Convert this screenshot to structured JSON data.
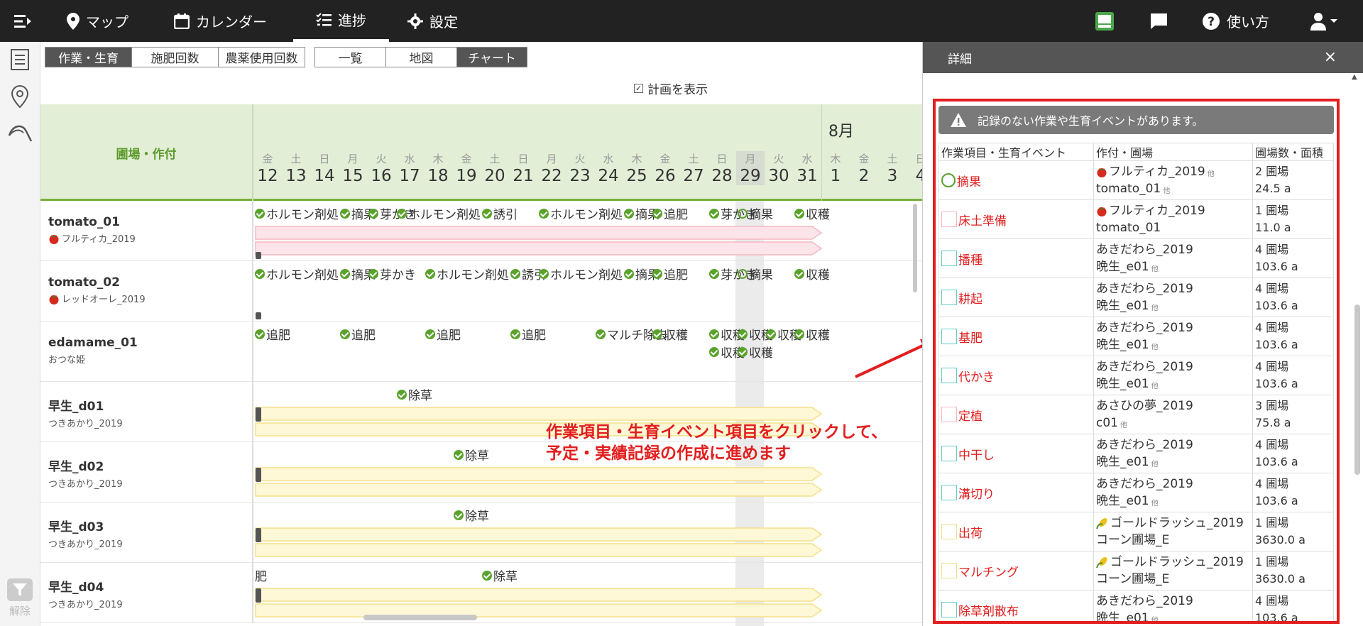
{
  "nav": {
    "map": "マップ",
    "calendar": "カレンダー",
    "progress": "進捗",
    "settings": "設定",
    "help": "使い方"
  },
  "filter": {
    "release": "解除"
  },
  "tabs_left": [
    "作業・生育",
    "施肥回数",
    "農薬使用回数"
  ],
  "tabs_right": [
    "一覧",
    "地図",
    "チャート"
  ],
  "plan_toggle": "計画を表示",
  "gantt": {
    "header_title": "圃場・作付",
    "month": "8月",
    "days": [
      {
        "dow": "金",
        "num": "12"
      },
      {
        "dow": "土",
        "num": "13"
      },
      {
        "dow": "日",
        "num": "14"
      },
      {
        "dow": "月",
        "num": "15"
      },
      {
        "dow": "火",
        "num": "16"
      },
      {
        "dow": "水",
        "num": "17"
      },
      {
        "dow": "木",
        "num": "18"
      },
      {
        "dow": "金",
        "num": "19"
      },
      {
        "dow": "土",
        "num": "20"
      },
      {
        "dow": "日",
        "num": "21"
      },
      {
        "dow": "月",
        "num": "22"
      },
      {
        "dow": "火",
        "num": "23"
      },
      {
        "dow": "水",
        "num": "24"
      },
      {
        "dow": "木",
        "num": "25"
      },
      {
        "dow": "金",
        "num": "26"
      },
      {
        "dow": "土",
        "num": "27"
      },
      {
        "dow": "日",
        "num": "28"
      },
      {
        "dow": "月",
        "num": "29"
      },
      {
        "dow": "火",
        "num": "30"
      },
      {
        "dow": "水",
        "num": "31"
      },
      {
        "dow": "木",
        "num": "1"
      },
      {
        "dow": "金",
        "num": "2"
      },
      {
        "dow": "土",
        "num": "3"
      },
      {
        "dow": "日",
        "num": "4"
      }
    ],
    "rows": [
      {
        "name": "tomato_01",
        "sub": "フルティカ_2019",
        "bar": "pink"
      },
      {
        "name": "tomato_02",
        "sub": "レッドオーレ_2019",
        "bar": "none"
      },
      {
        "name": "edamame_01",
        "sub": "おつな姫",
        "bar": "none"
      },
      {
        "name": "早生_d01",
        "sub": "つきあかり_2019",
        "bar": "yellow"
      },
      {
        "name": "早生_d02",
        "sub": "つきあかり_2019",
        "bar": "yellow"
      },
      {
        "name": "早生_d03",
        "sub": "つきあかり_2019",
        "bar": "yellow"
      },
      {
        "name": "早生_d04",
        "sub": "つきあかり_2019",
        "bar": "yellow"
      }
    ],
    "chips": [
      {
        "row": 0,
        "day": 0,
        "text": "ホルモン剤処",
        "line": 0
      },
      {
        "row": 0,
        "day": 3,
        "text": "摘果",
        "line": 0
      },
      {
        "row": 0,
        "day": 4,
        "text": "芽かき",
        "line": 0
      },
      {
        "row": 0,
        "day": 5,
        "text": "ホルモン剤処",
        "line": 0
      },
      {
        "row": 0,
        "day": 8,
        "text": "誘引",
        "line": 0
      },
      {
        "row": 0,
        "day": 10,
        "text": "ホルモン剤処",
        "line": 0
      },
      {
        "row": 0,
        "day": 13,
        "text": "摘果",
        "line": 0
      },
      {
        "row": 0,
        "day": 14,
        "text": "追肥",
        "line": 0
      },
      {
        "row": 0,
        "day": 16,
        "text": "芽かき",
        "line": 0
      },
      {
        "row": 0,
        "day": 17,
        "text": "摘果",
        "line": 0,
        "ring": true
      },
      {
        "row": 0,
        "day": 19,
        "text": "収穫",
        "line": 0
      },
      {
        "row": 1,
        "day": 0,
        "text": "ホルモン剤処",
        "line": 0
      },
      {
        "row": 1,
        "day": 3,
        "text": "摘果",
        "line": 0
      },
      {
        "row": 1,
        "day": 4,
        "text": "芽かき",
        "line": 0
      },
      {
        "row": 1,
        "day": 6,
        "text": "ホルモン剤処",
        "line": 0
      },
      {
        "row": 1,
        "day": 9,
        "text": "誘引",
        "line": 0
      },
      {
        "row": 1,
        "day": 10,
        "text": "ホルモン剤処",
        "line": 0
      },
      {
        "row": 1,
        "day": 13,
        "text": "摘果",
        "line": 0
      },
      {
        "row": 1,
        "day": 14,
        "text": "追肥",
        "line": 0
      },
      {
        "row": 1,
        "day": 16,
        "text": "芽かき",
        "line": 0
      },
      {
        "row": 1,
        "day": 17,
        "text": "摘果",
        "line": 0,
        "ring": true
      },
      {
        "row": 1,
        "day": 19,
        "text": "収穫",
        "line": 0
      },
      {
        "row": 2,
        "day": 0,
        "text": "追肥",
        "line": 0
      },
      {
        "row": 2,
        "day": 3,
        "text": "追肥",
        "line": 0
      },
      {
        "row": 2,
        "day": 6,
        "text": "追肥",
        "line": 0
      },
      {
        "row": 2,
        "day": 9,
        "text": "追肥",
        "line": 0
      },
      {
        "row": 2,
        "day": 12,
        "text": "マルチ除去",
        "line": 0
      },
      {
        "row": 2,
        "day": 14,
        "text": "収穫",
        "line": 0
      },
      {
        "row": 2,
        "day": 16,
        "text": "収穫",
        "line": 0
      },
      {
        "row": 2,
        "day": 17,
        "text": "収穫",
        "line": 0
      },
      {
        "row": 2,
        "day": 18,
        "text": "収穫",
        "line": 0
      },
      {
        "row": 2,
        "day": 19,
        "text": "収穫",
        "line": 0
      },
      {
        "row": 2,
        "day": 16,
        "text": "収穫",
        "line": 1
      },
      {
        "row": 2,
        "day": 17,
        "text": "収穫",
        "line": 1
      },
      {
        "row": 3,
        "day": 5,
        "text": "除草",
        "line": 0
      },
      {
        "row": 4,
        "day": 7,
        "text": "除草",
        "line": 0
      },
      {
        "row": 5,
        "day": 7,
        "text": "除草",
        "line": 0
      },
      {
        "row": 6,
        "day": 8,
        "text": "除草",
        "line": 0
      },
      {
        "row": 6,
        "day": 0,
        "text": "肥",
        "line": 0,
        "plain": true
      }
    ]
  },
  "callout": [
    "作業項目・生育イベント項目をクリックして、",
    "予定・実績記録の作成に進めます"
  ],
  "detail": {
    "title": "詳細",
    "close": "×",
    "warning": "記録のない作業や生育イベントがあります。",
    "columns": [
      "作業項目・生育イベント",
      "作付・圃場",
      "圃場数・面積"
    ],
    "other_mark": "他",
    "rows": [
      {
        "event": "摘果",
        "mark": "ring",
        "crop": "フルティカ_2019",
        "crop_icon": "tomato",
        "crop_other": true,
        "field": "tomato_01",
        "field_other": true,
        "count": "2 圃場",
        "area": "24.5 a"
      },
      {
        "event": "床土準備",
        "mark": "pink",
        "crop": "フルティカ_2019",
        "crop_icon": "tomato",
        "crop_other": false,
        "field": "tomato_01",
        "field_other": false,
        "count": "1 圃場",
        "area": "11.0 a"
      },
      {
        "event": "播種",
        "mark": "cyan",
        "crop": "あきだわら_2019",
        "crop_icon": "",
        "crop_other": false,
        "field": "晩生_e01",
        "field_other": true,
        "count": "4 圃場",
        "area": "103.6 a"
      },
      {
        "event": "耕起",
        "mark": "cyan",
        "crop": "あきだわら_2019",
        "crop_icon": "",
        "crop_other": false,
        "field": "晩生_e01",
        "field_other": true,
        "count": "4 圃場",
        "area": "103.6 a"
      },
      {
        "event": "基肥",
        "mark": "cyan",
        "crop": "あきだわら_2019",
        "crop_icon": "",
        "crop_other": false,
        "field": "晩生_e01",
        "field_other": true,
        "count": "4 圃場",
        "area": "103.6 a"
      },
      {
        "event": "代かき",
        "mark": "cyan",
        "crop": "あきだわら_2019",
        "crop_icon": "",
        "crop_other": false,
        "field": "晩生_e01",
        "field_other": true,
        "count": "4 圃場",
        "area": "103.6 a"
      },
      {
        "event": "定植",
        "mark": "pink",
        "crop": "あさひの夢_2019",
        "crop_icon": "",
        "crop_other": false,
        "field": "c01",
        "field_other": true,
        "count": "3 圃場",
        "area": "75.8 a"
      },
      {
        "event": "中干し",
        "mark": "cyan",
        "crop": "あきだわら_2019",
        "crop_icon": "",
        "crop_other": false,
        "field": "晩生_e01",
        "field_other": true,
        "count": "4 圃場",
        "area": "103.6 a"
      },
      {
        "event": "溝切り",
        "mark": "cyan",
        "crop": "あきだわら_2019",
        "crop_icon": "",
        "crop_other": false,
        "field": "晩生_e01",
        "field_other": true,
        "count": "4 圃場",
        "area": "103.6 a"
      },
      {
        "event": "出荷",
        "mark": "yellow",
        "crop": "ゴールドラッシュ_2019",
        "crop_icon": "corn",
        "crop_other": false,
        "field": "コーン圃場_E",
        "field_other": false,
        "count": "1 圃場",
        "area": "3630.0 a"
      },
      {
        "event": "マルチング",
        "mark": "yellow",
        "crop": "ゴールドラッシュ_2019",
        "crop_icon": "corn",
        "crop_other": false,
        "field": "コーン圃場_E",
        "field_other": false,
        "count": "1 圃場",
        "area": "3630.0 a"
      },
      {
        "event": "除草剤散布",
        "mark": "cyan",
        "crop": "あきだわら_2019",
        "crop_icon": "",
        "crop_other": false,
        "field": "晩生_e01",
        "field_other": true,
        "count": "4 圃場",
        "area": "103.6 a"
      }
    ]
  },
  "colors": {
    "topbar": "#222222",
    "accent_green": "#5aa22c",
    "red": "#e21e1e",
    "header_green": "#e2eed6"
  }
}
